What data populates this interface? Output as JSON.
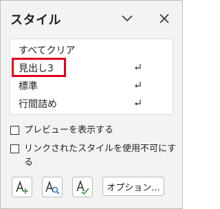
{
  "pane": {
    "title": "スタイル",
    "header_icons": [
      "chevron-down-icon",
      "close-icon"
    ]
  },
  "style_list": {
    "items": [
      {
        "label": "すべてクリア",
        "paragraph_mark": false
      },
      {
        "label": "見出し3",
        "paragraph_mark": true,
        "highlighted": true
      },
      {
        "label": "標準",
        "paragraph_mark": true
      },
      {
        "label": "行間詰め",
        "paragraph_mark": true
      }
    ],
    "highlight_color": "#e3001b"
  },
  "options": {
    "show_preview": {
      "label": "プレビューを表示する",
      "checked": false
    },
    "disable_linked": {
      "label": "リンクされたスタイルを使用不可にする",
      "checked": false
    }
  },
  "footer": {
    "icon_buttons": [
      "new-style-icon",
      "style-inspector-icon",
      "manage-styles-icon"
    ],
    "options_button": "オプション..."
  },
  "colors": {
    "pane_bg": "#f3f3f3",
    "inspector_blue": "#2b72c4",
    "manage_green": "#3a9a3a"
  }
}
